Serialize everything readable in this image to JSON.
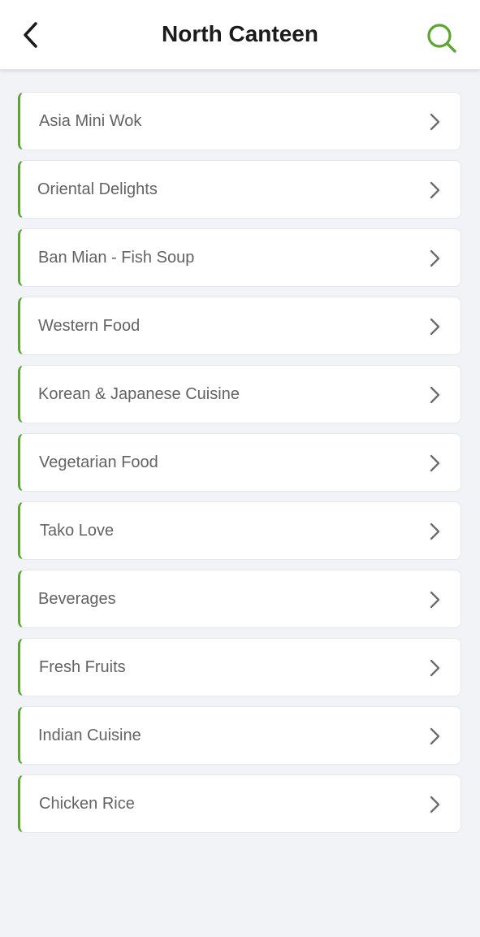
{
  "header": {
    "title": "North Canteen",
    "back_icon": "chevron-left-icon",
    "search_icon": "search-icon"
  },
  "colors": {
    "accent": "#5ca631",
    "background": "#f2f3f7",
    "card": "#ffffff",
    "text": "#636363",
    "title": "#1b1b1b"
  },
  "stalls": [
    {
      "label": "Asia Mini Wok"
    },
    {
      "label": "Oriental Delights"
    },
    {
      "label": "Ban Mian - Fish Soup"
    },
    {
      "label": "Western Food"
    },
    {
      "label": "Korean & Japanese Cuisine"
    },
    {
      "label": "Vegetarian Food"
    },
    {
      "label": "Tako Love"
    },
    {
      "label": "Beverages"
    },
    {
      "label": "Fresh Fruits"
    },
    {
      "label": "Indian Cuisine"
    },
    {
      "label": "Chicken Rice"
    }
  ]
}
